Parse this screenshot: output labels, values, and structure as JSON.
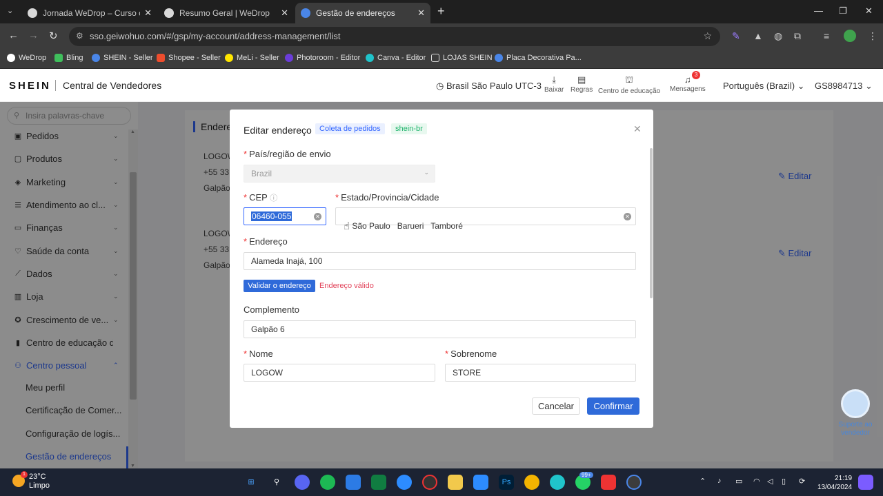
{
  "browser": {
    "tabs": [
      {
        "title": "Jornada WeDrop – Curso comp",
        "close": "✕"
      },
      {
        "title": "Resumo Geral | WeDrop",
        "close": "✕"
      },
      {
        "title": "Gestão de endereços",
        "close": "✕"
      }
    ],
    "new_tab": "+",
    "url": "sso.geiwohuo.com/#/gsp/my-account/address-management/list",
    "bookmarks": [
      "WeDrop",
      "Bling",
      "SHEIN - Seller",
      "Shopee - Seller",
      "MeLi - Seller",
      "Photoroom - Editor",
      "Canva - Editor",
      "LOJAS SHEIN",
      "Placa Decorativa Pa..."
    ]
  },
  "header": {
    "logo": "SHEIN",
    "title": "Central de Vendedores",
    "timezone": "Brasil São Paulo UTC-3",
    "icons": [
      {
        "label": "Baixar",
        "icon": "download-icon"
      },
      {
        "label": "Regras",
        "icon": "document-icon"
      },
      {
        "label": "Centro de educação",
        "icon": "graduation-cap-icon"
      },
      {
        "label": "Mensagens",
        "icon": "bell-icon"
      }
    ],
    "messages_badge": "3",
    "language": "Português (Brazil)",
    "user": "GS8984713"
  },
  "sidebar": {
    "search_placeholder": "Insira palavras-chave",
    "items": [
      {
        "label": "Pedidos",
        "icon": "orders-icon"
      },
      {
        "label": "Produtos",
        "icon": "products-icon"
      },
      {
        "label": "Marketing",
        "icon": "marketing-icon"
      },
      {
        "label": "Atendimento ao cl...",
        "icon": "support-icon"
      },
      {
        "label": "Finanças",
        "icon": "finance-icon"
      },
      {
        "label": "Saúde da conta",
        "icon": "health-icon"
      },
      {
        "label": "Dados",
        "icon": "data-chart-icon"
      },
      {
        "label": "Loja",
        "icon": "store-icon"
      },
      {
        "label": "Crescimento de ve...",
        "icon": "growth-icon"
      },
      {
        "label": "Centro de educação d...",
        "icon": "education-icon"
      },
      {
        "label": "Centro pessoal",
        "icon": "person-icon"
      }
    ],
    "subitems": [
      "Meu perfil",
      "Certificação de Comer...",
      "Configuração de logís...",
      "Gestão de endereços"
    ]
  },
  "page": {
    "title": "Endere",
    "addresses": [
      {
        "line1": "LOGOW",
        "line2": "+55 33",
        "line3": "Galpão"
      },
      {
        "line1": "LOGOW",
        "line2": "+55 33",
        "line3": "Galpão"
      }
    ],
    "edit_label": "Editar"
  },
  "dialog": {
    "title": "Editar endereço",
    "tags": [
      "Coleta de pedidos",
      "shein-br"
    ],
    "country_label": "País/região de envio",
    "country_value": "Brazil",
    "cep_label": "CEP",
    "cep_value": "06460-055",
    "state_label": "Estado/Provincia/Cidade",
    "state_value": "São Paulo   Barueri   Tamboré",
    "address_label": "Endereço",
    "address_value": "Alameda Inajá, 100",
    "validate_button": "Validar o endereço",
    "valid_text": "Endereço válido",
    "complement_label": "Complemento",
    "complement_value": "Galpão 6",
    "first_name_label": "Nome",
    "first_name_value": "LOGOW",
    "last_name_label": "Sobrenome",
    "last_name_value": "STORE",
    "cancel": "Cancelar",
    "confirm": "Confirmar"
  },
  "support": "Suporte ao vendedor",
  "taskbar": {
    "weather_temp": "23°C",
    "weather_text": "Limpo",
    "weather_badge": "1",
    "time": "21:19",
    "date": "13/04/2024",
    "whatsapp_badge": "99+"
  },
  "colors": {
    "accent": "#3366ff",
    "button": "#2f6ad9",
    "required": "#e33333",
    "valid_text": "#e2435a",
    "taskbar": "#1c2333"
  }
}
